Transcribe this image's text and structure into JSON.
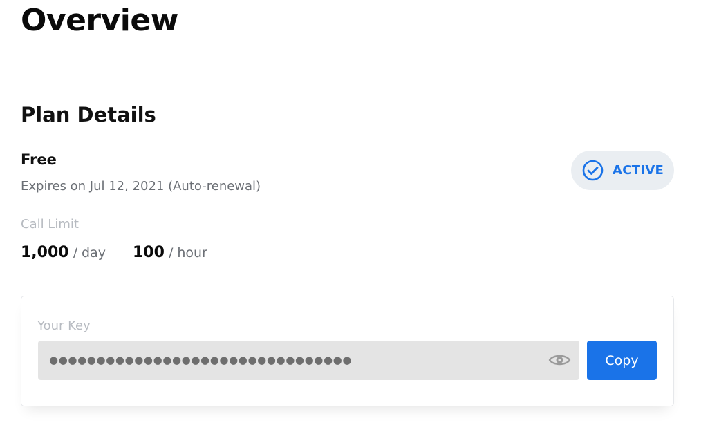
{
  "page": {
    "title": "Overview"
  },
  "plan_details": {
    "section_title": "Plan Details",
    "plan_name": "Free",
    "expiry_text": "Expires on Jul 12, 2021 (Auto-renewal)",
    "status": {
      "label": "ACTIVE",
      "icon": "check-circle-icon",
      "color": "#1a73e8",
      "background": "#eaeef2"
    },
    "call_limit": {
      "label": "Call Limit",
      "daily": {
        "value": "1,000",
        "unit": "/ day"
      },
      "hourly": {
        "value": "100",
        "unit": "/ hour"
      }
    }
  },
  "key_panel": {
    "label": "Your Key",
    "masked_value": "●●●●●●●●●●●●●●●●●●●●●●●●●●●●●●●●",
    "reveal_icon": "eye-icon",
    "copy_label": "Copy",
    "accent_color": "#1a73e8"
  }
}
